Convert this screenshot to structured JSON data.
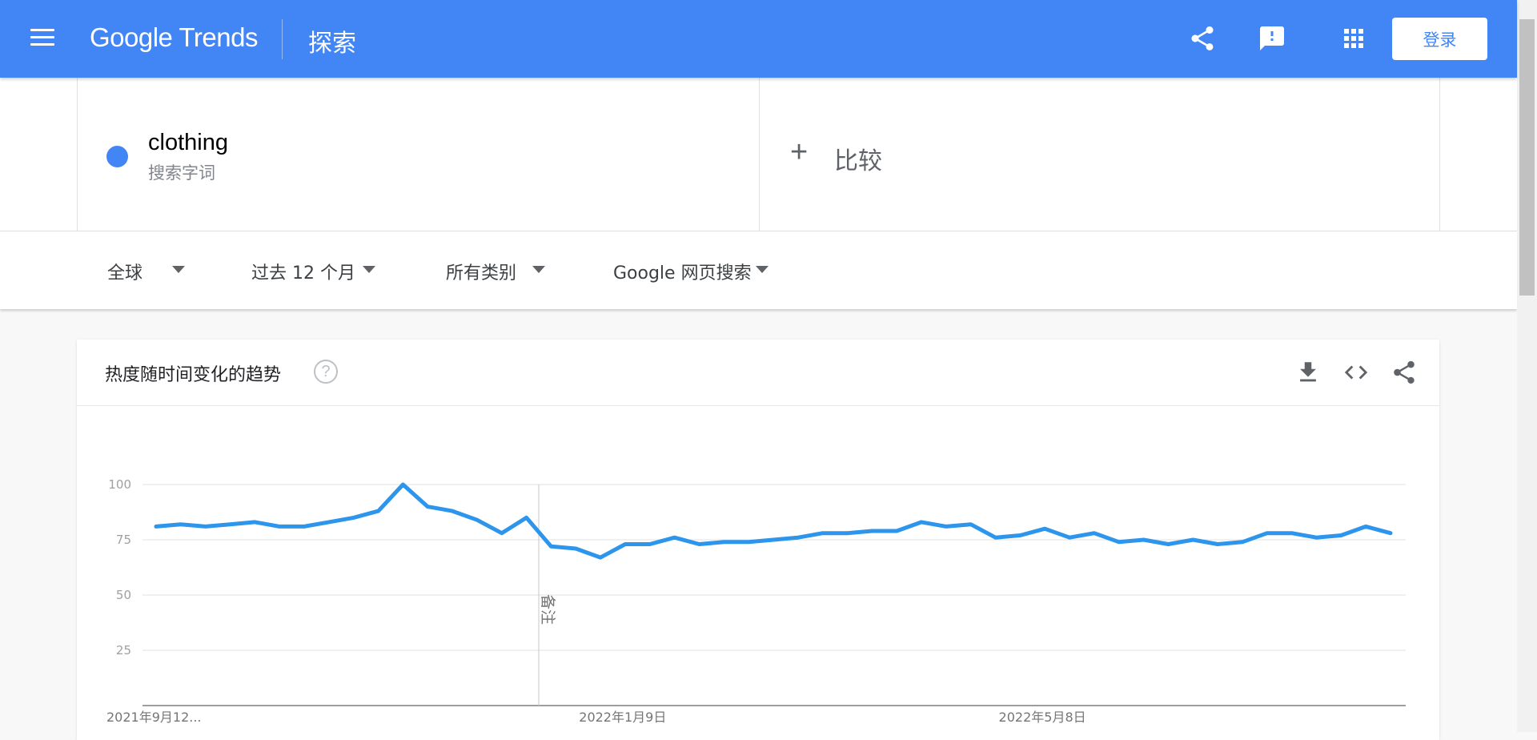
{
  "header": {
    "logo": "Google Trends",
    "logo_google": "Google",
    "logo_trends": "Trends",
    "page_title": "探索",
    "login_label": "登录",
    "icons": [
      "menu-icon",
      "share-icon",
      "feedback-icon",
      "apps-grid-icon"
    ]
  },
  "search": {
    "term": "clothing",
    "term_type": "搜索字词",
    "term_color": "#4285f4",
    "compare_plus": "+",
    "compare_label": "比较"
  },
  "filters": {
    "region": "全球",
    "time_range": "过去 12 个月",
    "category": "所有类别",
    "search_type": "Google 网页搜索"
  },
  "card": {
    "title": "热度随时间变化的趋势",
    "help": "?",
    "icons": [
      "download-icon",
      "embed-code-icon",
      "share-icon"
    ]
  },
  "chart_data": {
    "type": "line",
    "series": [
      {
        "name": "clothing",
        "color": "#2d95ec",
        "values": [
          81,
          82,
          81,
          82,
          83,
          81,
          81,
          83,
          85,
          88,
          100,
          90,
          88,
          84,
          78,
          85,
          72,
          71,
          67,
          73,
          73,
          76,
          73,
          74,
          74,
          75,
          76,
          78,
          78,
          79,
          79,
          83,
          81,
          82,
          76,
          77,
          80,
          76,
          78,
          74,
          75,
          73,
          75,
          73,
          74,
          78,
          78,
          76,
          77,
          81,
          78
        ]
      }
    ],
    "yticks": [
      25,
      50,
      75,
      100
    ],
    "ytick_labels": [
      "25",
      "50",
      "75",
      "100"
    ],
    "ylim": [
      0,
      100
    ],
    "xtick_labels": [
      "2021年9月12...",
      "2022年1月9日",
      "2022年5月8日"
    ],
    "xtick_index": [
      0,
      17,
      34
    ],
    "annotation": {
      "label": "备注",
      "index": 15.5
    },
    "grid": true
  }
}
